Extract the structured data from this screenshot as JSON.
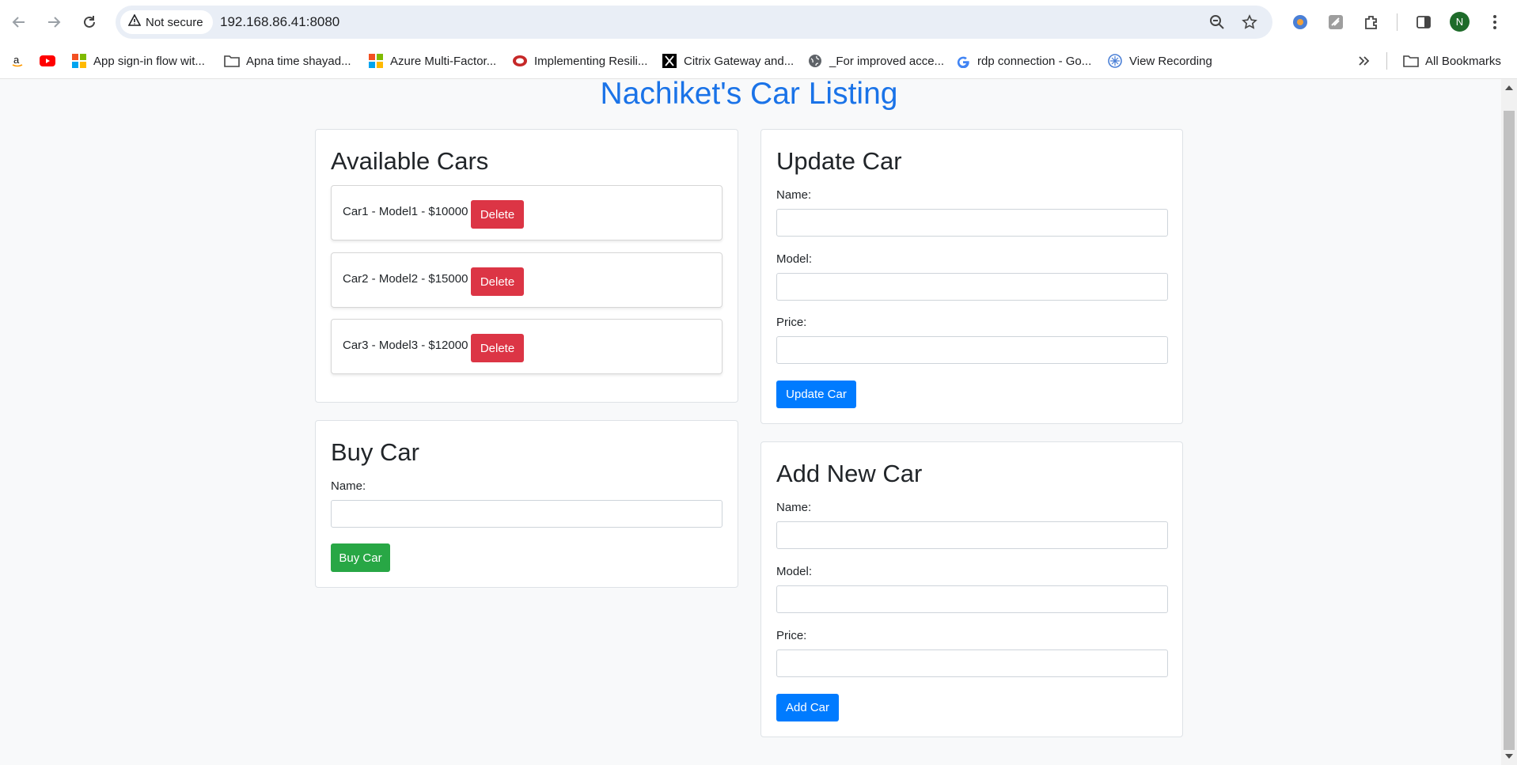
{
  "browser": {
    "security_label": "Not secure",
    "url": "192.168.86.41:8080",
    "avatar_letter": "N",
    "bookmarks": [
      {
        "label": "App sign-in flow wit..."
      },
      {
        "label": "Apna time shayad..."
      },
      {
        "label": "Azure Multi-Factor..."
      },
      {
        "label": "Implementing Resili..."
      },
      {
        "label": "Citrix Gateway and..."
      },
      {
        "label": "_For improved acce..."
      },
      {
        "label": "rdp connection - Go..."
      },
      {
        "label": "View Recording"
      }
    ],
    "all_bookmarks_label": "All Bookmarks"
  },
  "page": {
    "title": "Nachiket's Car Listing"
  },
  "available_cars": {
    "heading": "Available Cars",
    "delete_label": "Delete",
    "items": [
      {
        "text": "Car1 - Model1 - $10000"
      },
      {
        "text": "Car2 - Model2 - $15000"
      },
      {
        "text": "Car3 - Model3 - $12000"
      }
    ]
  },
  "buy_car": {
    "heading": "Buy Car",
    "name_label": "Name:",
    "name_value": "",
    "button_label": "Buy Car"
  },
  "update_car": {
    "heading": "Update Car",
    "name_label": "Name:",
    "model_label": "Model:",
    "price_label": "Price:",
    "name_value": "",
    "model_value": "",
    "price_value": "",
    "button_label": "Update Car"
  },
  "add_car": {
    "heading": "Add New Car",
    "name_label": "Name:",
    "model_label": "Model:",
    "price_label": "Price:",
    "name_value": "",
    "model_value": "",
    "price_value": "",
    "button_label": "Add Car"
  },
  "colors": {
    "title": "#1a73e8",
    "primary": "#007bff",
    "danger": "#dc3545",
    "success": "#28a745"
  }
}
